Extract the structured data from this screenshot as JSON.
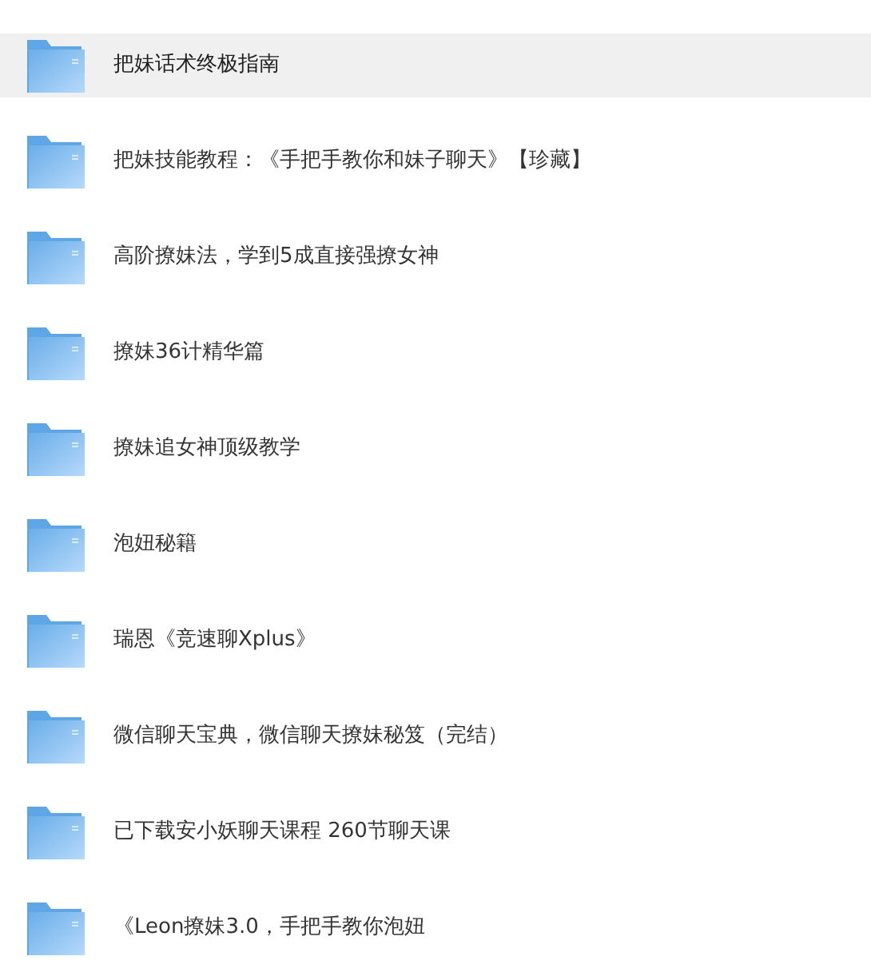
{
  "folders": [
    {
      "name": "把妹话术终极指南",
      "selected": true
    },
    {
      "name": "把妹技能教程：《手把手教你和妹子聊天》【珍藏】",
      "selected": false
    },
    {
      "name": "高阶撩妹法，学到5成直接强撩女神",
      "selected": false
    },
    {
      "name": "撩妹36计精华篇",
      "selected": false
    },
    {
      "name": "撩妹追女神顶级教学",
      "selected": false
    },
    {
      "name": "泡妞秘籍",
      "selected": false
    },
    {
      "name": "瑞恩《竞速聊Xplus》",
      "selected": false
    },
    {
      "name": "微信聊天宝典，微信聊天撩妹秘笈（完结）",
      "selected": false
    },
    {
      "name": "已下载安小妖聊天课程 260节聊天课",
      "selected": false
    },
    {
      "name": "《Leon撩妹3.0，手把手教你泡妞",
      "selected": false
    }
  ]
}
